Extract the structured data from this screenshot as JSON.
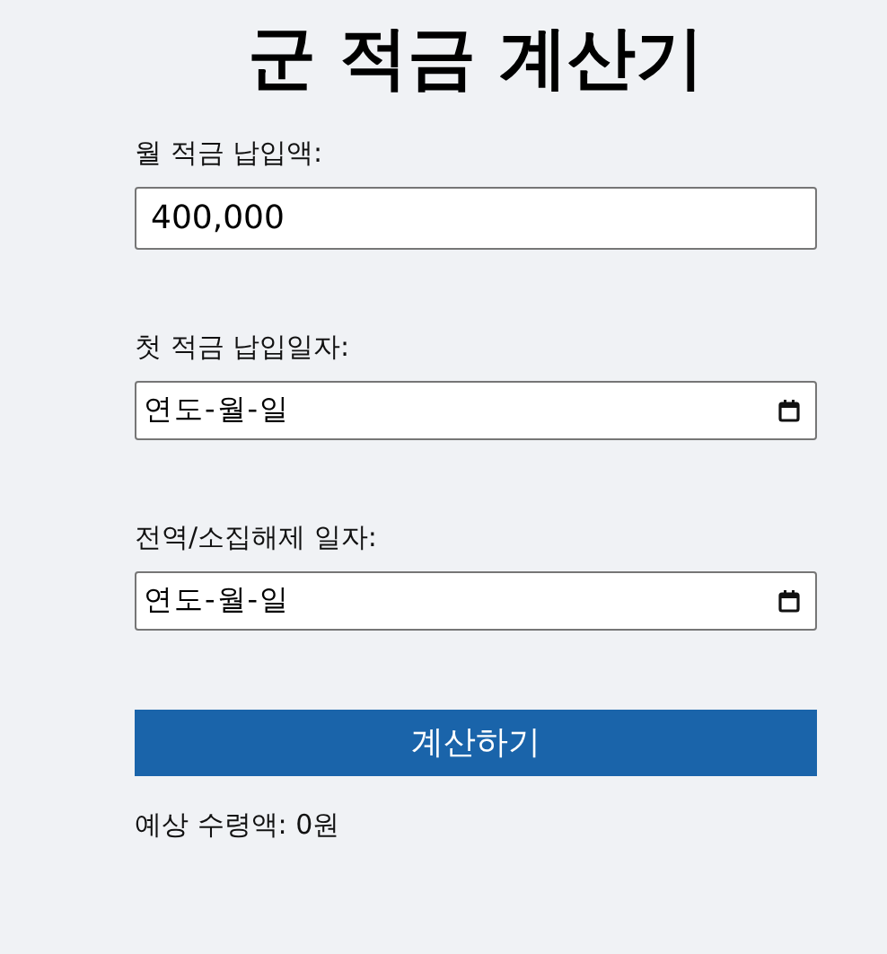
{
  "title": "군 적금 계산기",
  "fields": [
    {
      "kind": "number",
      "label": "월 적금 납입액:",
      "value": "400,000"
    },
    {
      "kind": "date",
      "label": "첫 적금 납입일자:",
      "placeholder": "연도-월-일"
    },
    {
      "kind": "date",
      "label": "전역/소집해제 일자:",
      "placeholder": "연도-월-일"
    }
  ],
  "button": "계산하기",
  "result": "예상 수령액: 0원"
}
